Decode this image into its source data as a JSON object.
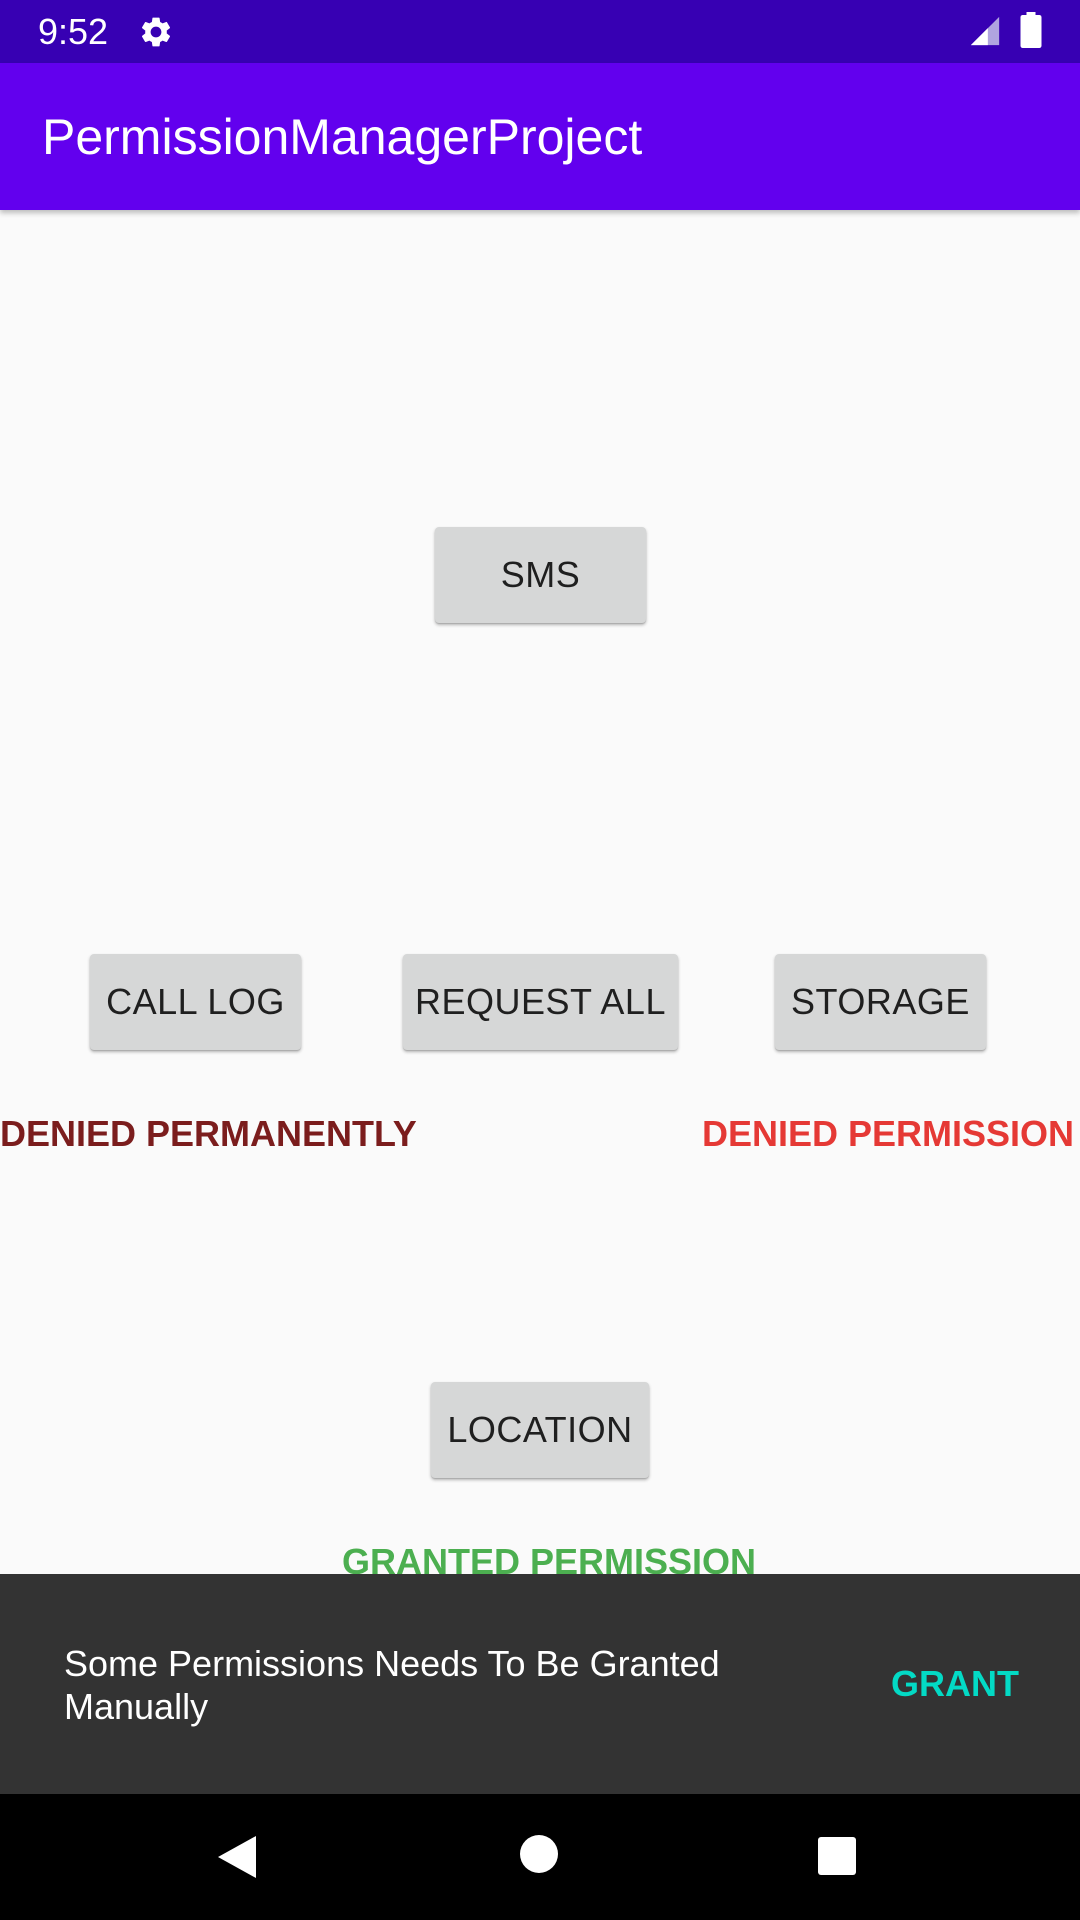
{
  "status_bar": {
    "time": "9:52",
    "icons": [
      "gear-icon",
      "signal-icon",
      "battery-icon"
    ]
  },
  "app_bar": {
    "title": "PermissionManagerProject"
  },
  "buttons": {
    "sms": "SMS",
    "call_log": "CALL LOG",
    "request_all": "REQUEST ALL",
    "storage": "STORAGE",
    "location": "LOCATION"
  },
  "statuses": {
    "call_log": "DENIED PERMANENTLY",
    "storage": "DENIED PERMISSION",
    "location": "GRANTED PERMISSION"
  },
  "snackbar": {
    "message": "Some Permissions Needs To Be Granted Manually",
    "action": "GRANT"
  },
  "colors": {
    "status_bar": "#3700b3",
    "app_bar": "#6200ee",
    "denied_permanently": "#7b1d1d",
    "denied": "#e53935",
    "granted": "#4caf50",
    "snackbar_action": "#03dac5"
  },
  "nav_bar": {
    "icons": [
      "back-icon",
      "home-icon",
      "recents-icon"
    ]
  }
}
